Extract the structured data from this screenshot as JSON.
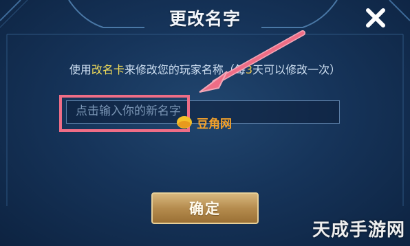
{
  "dialog": {
    "title": "更改名字",
    "hint": {
      "prefix": "使用",
      "card": "改名卡",
      "middle": "来修改您的玩家名称（",
      "obscured": "每",
      "days": "3",
      "suffix": "天可以修改一次）"
    },
    "input_placeholder": "点击输入你的新名字",
    "confirm_label": "确定"
  },
  "icons": {
    "close": "close-icon",
    "arrow": "arrow-annotation"
  },
  "watermarks": {
    "top": "豆角网",
    "bottom": "天成手游网"
  },
  "colors": {
    "highlight_text": "#f1dc5a",
    "annotation": "#ef6d86",
    "button": "#b58c4e",
    "background": "#16345a"
  }
}
